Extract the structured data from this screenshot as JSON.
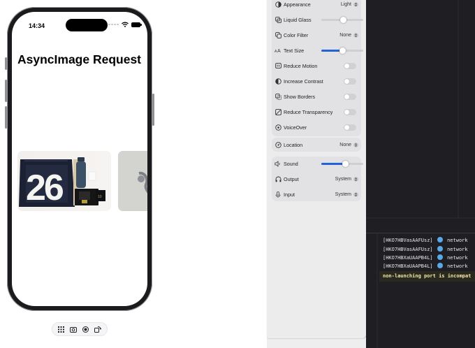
{
  "simulator": {
    "status_time": "14:34",
    "page_title": "AsyncImage Request",
    "toolbar_icons": [
      "grid-icon",
      "screenshot-icon",
      "record-icon",
      "rotate-icon"
    ]
  },
  "settings": {
    "items": [
      {
        "label": "Appearance",
        "value": "Light",
        "control": "menu",
        "icon": "appearance-icon"
      },
      {
        "label": "Liquid Glass",
        "control": "slider",
        "level": 0.5,
        "icon": "liquid-glass-icon"
      },
      {
        "label": "Color Filter",
        "value": "None",
        "control": "menu",
        "icon": "color-filter-icon"
      },
      {
        "label": "Text Size",
        "control": "slider",
        "level": 0.5,
        "icon": "text-size-icon"
      },
      {
        "label": "Reduce Motion",
        "control": "toggle",
        "on": false,
        "icon": "reduce-motion-icon"
      },
      {
        "label": "Increase Contrast",
        "control": "toggle",
        "on": false,
        "icon": "contrast-icon"
      },
      {
        "label": "Show Borders",
        "control": "toggle",
        "on": false,
        "icon": "borders-icon"
      },
      {
        "label": "Reduce Transparency",
        "control": "toggle",
        "on": false,
        "icon": "transparency-icon"
      },
      {
        "label": "VoiceOver",
        "control": "toggle",
        "on": false,
        "icon": "voiceover-icon"
      },
      {
        "label": "Location",
        "value": "None",
        "control": "menu",
        "icon": "location-icon"
      },
      {
        "label": "Sound",
        "control": "slider",
        "level": 0.55,
        "icon": "speaker-icon"
      },
      {
        "label": "Output",
        "value": "System",
        "control": "menu",
        "icon": "headphones-icon"
      },
      {
        "label": "Input",
        "value": "System",
        "control": "menu",
        "icon": "microphone-icon"
      }
    ]
  },
  "console": {
    "lines": [
      {
        "prefix": "[HKO7HBVasAAFUsz]",
        "message": "network"
      },
      {
        "prefix": "[HKO7HBVasAAFUsz]",
        "message": "network"
      },
      {
        "prefix": "[HKO7HBXaUAAPB4L]",
        "message": "network"
      },
      {
        "prefix": "[HKO7HBXaUAAPB4L]",
        "message": "network"
      }
    ],
    "warning": "non-launching port is incompat"
  },
  "colors": {
    "accent": "#2462d8",
    "console_background": "#1f1f23",
    "warning_text": "#f4e7a6"
  }
}
